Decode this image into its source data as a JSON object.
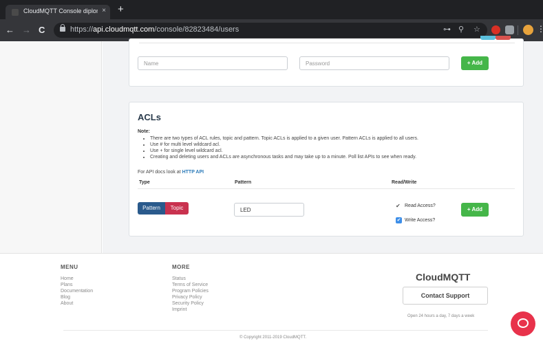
{
  "browser": {
    "tab_title": "CloudMQTT Console diplomsk",
    "tab_close": "×",
    "new_tab": "+",
    "back": "←",
    "forward": "→",
    "reload": "C",
    "url_scheme": "https://",
    "url_host": "api.cloudmqtt.com",
    "url_path": "/console/82823484/users",
    "key_icon": "⊶",
    "zoom_icon": "⚲",
    "star_icon": "☆",
    "menu_icon": "⋮"
  },
  "users": {
    "name_placeholder": "Name",
    "password_placeholder": "Password",
    "add_label": "+ Add"
  },
  "acls": {
    "title": "ACLs",
    "note_label": "Note:",
    "notes": [
      "There are two types of ACL rules, topic and pattern. Topic ACLs is applied to a given user. Pattern ACLs is applied to all users.",
      "Use # for multi level wildcard acl.",
      "Use + for single level wildcard acl.",
      "Creating and deleting users and ACLs are asynchronous tasks and may take up to a minute. Poll list APIs to see when ready."
    ],
    "api_text": "For API docs look at ",
    "api_link": "HTTP API",
    "columns": {
      "type": "Type",
      "pattern": "Pattern",
      "rw": "Read/Write"
    },
    "toggle": {
      "pattern": "Pattern",
      "topic": "Topic"
    },
    "pattern_value": "LED",
    "read_label": "Read Access?",
    "write_label": "Write Access?",
    "read_mark": "✔",
    "write_mark": "✔",
    "add_label": "+ Add"
  },
  "footer": {
    "menu_title": "MENU",
    "menu_items": [
      "Home",
      "Plans",
      "Documentation",
      "Blog",
      "About"
    ],
    "more_title": "MORE",
    "more_items": [
      "Status",
      "Terms of Service",
      "Program Policies",
      "Privacy Policy",
      "Security Policy",
      "Imprint"
    ],
    "brand": "CloudMQTT",
    "support_label": "Contact Support",
    "hours": "Open 24 hours a day, 7 days a week",
    "copyright": "© Copyright 2011-2019 CloudMQTT."
  }
}
